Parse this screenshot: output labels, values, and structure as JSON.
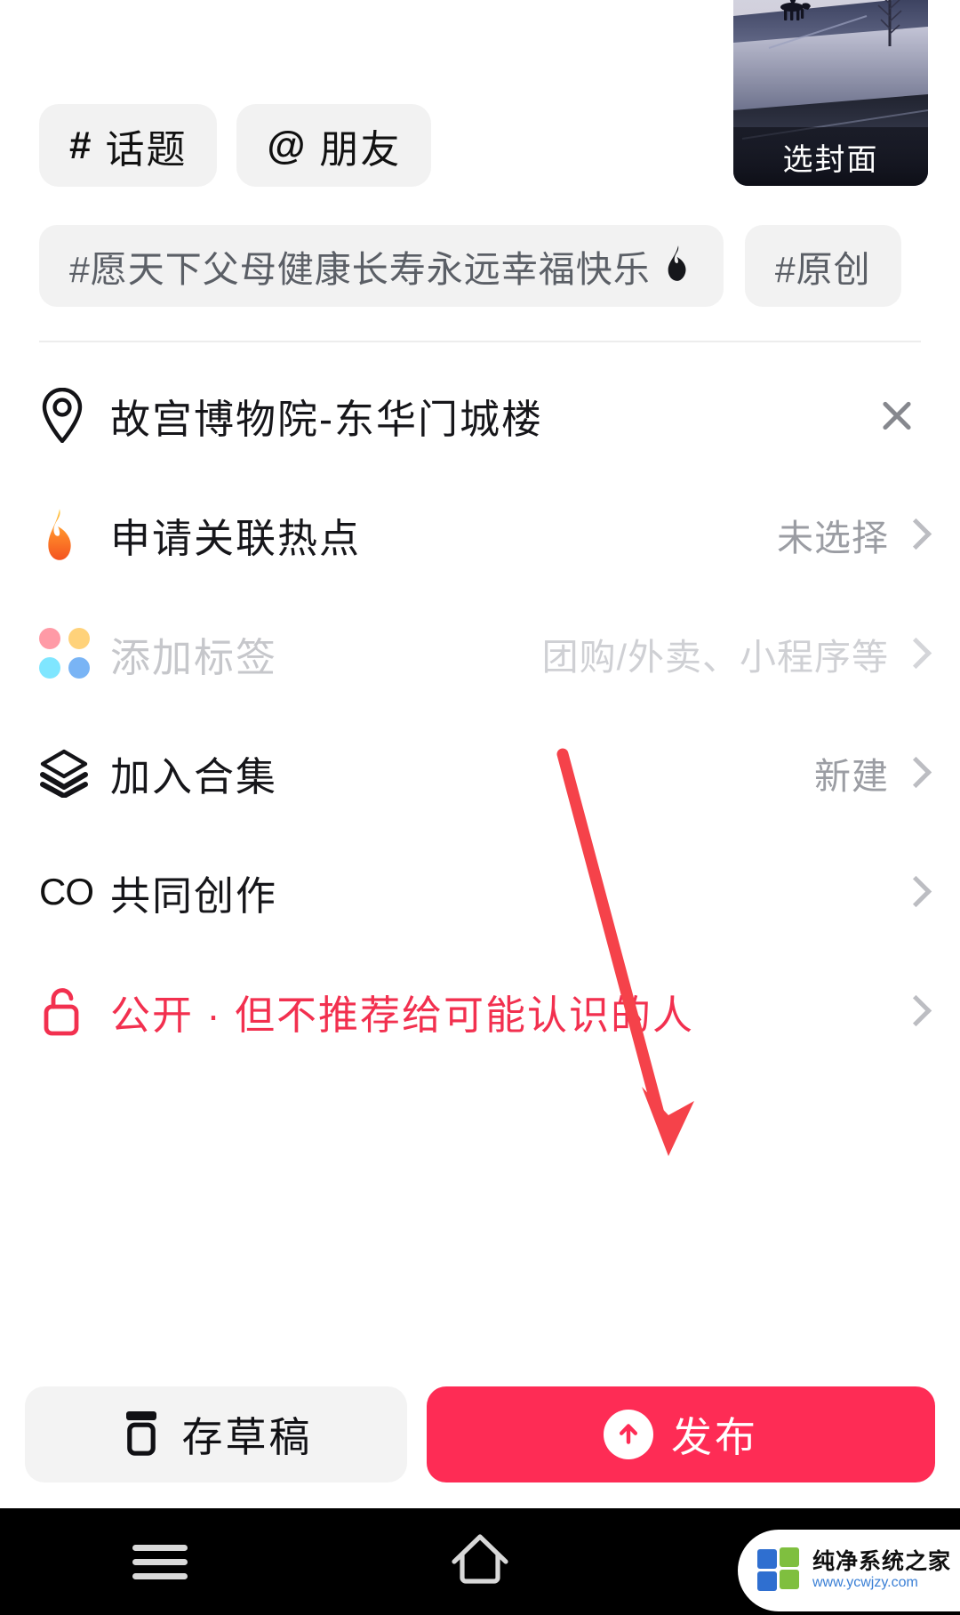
{
  "app": {
    "accent_color": "#fe2c55",
    "privacy_color": "#f2304f"
  },
  "compose_toolbar": {
    "items": [
      {
        "symbol": "#",
        "label": "话题",
        "icon": "hashtag-icon"
      },
      {
        "symbol": "@",
        "label": "朋友",
        "icon": "at-icon"
      }
    ]
  },
  "cover": {
    "label": "选封面",
    "icon": "cover-thumbnail"
  },
  "hashtag_suggestions": [
    {
      "text": "#愿天下父母健康长寿永远幸福快乐",
      "trending_icon": "fire-icon"
    },
    {
      "text": "#原创",
      "trending_icon": ""
    }
  ],
  "settings_rows": [
    {
      "icon": "location-pin-icon",
      "label": "故宫博物院-东华门城楼",
      "value": "",
      "trailing": "close-icon",
      "state": "selected"
    },
    {
      "icon": "fire-icon",
      "label": "申请关联热点",
      "value": "未选择",
      "trailing": "chevron-right-icon",
      "state": "normal"
    },
    {
      "icon": "four-dots-icon",
      "label": "添加标签",
      "value": "团购/外卖、小程序等",
      "trailing": "chevron-right-icon",
      "state": "disabled"
    },
    {
      "icon": "layers-icon",
      "label": "加入合集",
      "value": "新建",
      "trailing": "chevron-right-icon",
      "state": "normal"
    },
    {
      "icon": "co-create-icon",
      "label": "共同创作",
      "value": "",
      "trailing": "chevron-right-icon",
      "state": "normal"
    },
    {
      "icon": "unlock-icon",
      "label": "公开 · 但不推荐给可能认识的人",
      "value": "",
      "trailing": "chevron-right-icon",
      "state": "accent"
    }
  ],
  "action_bar": {
    "draft_label": "存草稿",
    "draft_icon": "draft-box-icon",
    "publish_label": "发布",
    "publish_icon": "arrow-up-circle-icon"
  },
  "system_nav": {
    "menu_icon": "menu-icon",
    "home_icon": "home-icon",
    "back_icon": "back-icon"
  },
  "watermark": {
    "title": "纯净系统之家",
    "url": "www.ycwjzy.com"
  },
  "annotation": {
    "type": "arrow",
    "color": "#f5424a",
    "points_to": "publish-button"
  }
}
